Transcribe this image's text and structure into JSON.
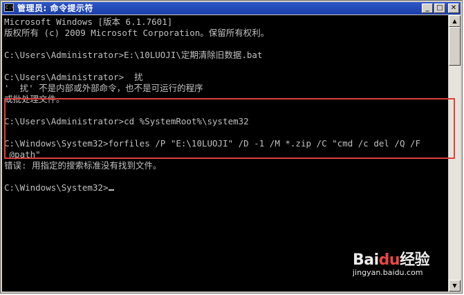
{
  "window": {
    "title": "管理员: 命令提示符",
    "app_icon_text": "C:\\",
    "minimize_glyph": "_",
    "maximize_glyph": "□",
    "close_glyph": "✕"
  },
  "console": {
    "lines": [
      "Microsoft Windows [版本 6.1.7601]",
      "版权所有 (c) 2009 Microsoft Corporation。保留所有权利。",
      "",
      "C:\\Users\\Administrator>E:\\10LUOJI\\定期清除旧数据.bat",
      "",
      "C:\\Users\\Administrator>  扰",
      "'  扰' 不是内部或外部命令，也不是可运行的程序",
      "或批处理文件。",
      "",
      "C:\\Users\\Administrator>cd %SystemRoot%\\system32",
      "",
      "C:\\Windows\\System32>forfiles /P \"E:\\10LUOJI\" /D -1 /M *.zip /C \"cmd /c del /Q /F",
      " @path\"",
      "错误: 用指定的搜索标准没有找到文件。",
      "",
      "C:\\Windows\\System32>"
    ]
  },
  "scrollbar": {
    "up_glyph": "▲",
    "down_glyph": "▼"
  },
  "watermark": {
    "logo": "Bai",
    "logo_mark": "du",
    "logo_suffix": "经验",
    "site": "jingyan.baidu.com"
  },
  "colors": {
    "console_bg": "#000000",
    "console_text": "#c0c0c0",
    "highlight_border": "#e0403a",
    "titlebar": "#1c3ea9"
  }
}
